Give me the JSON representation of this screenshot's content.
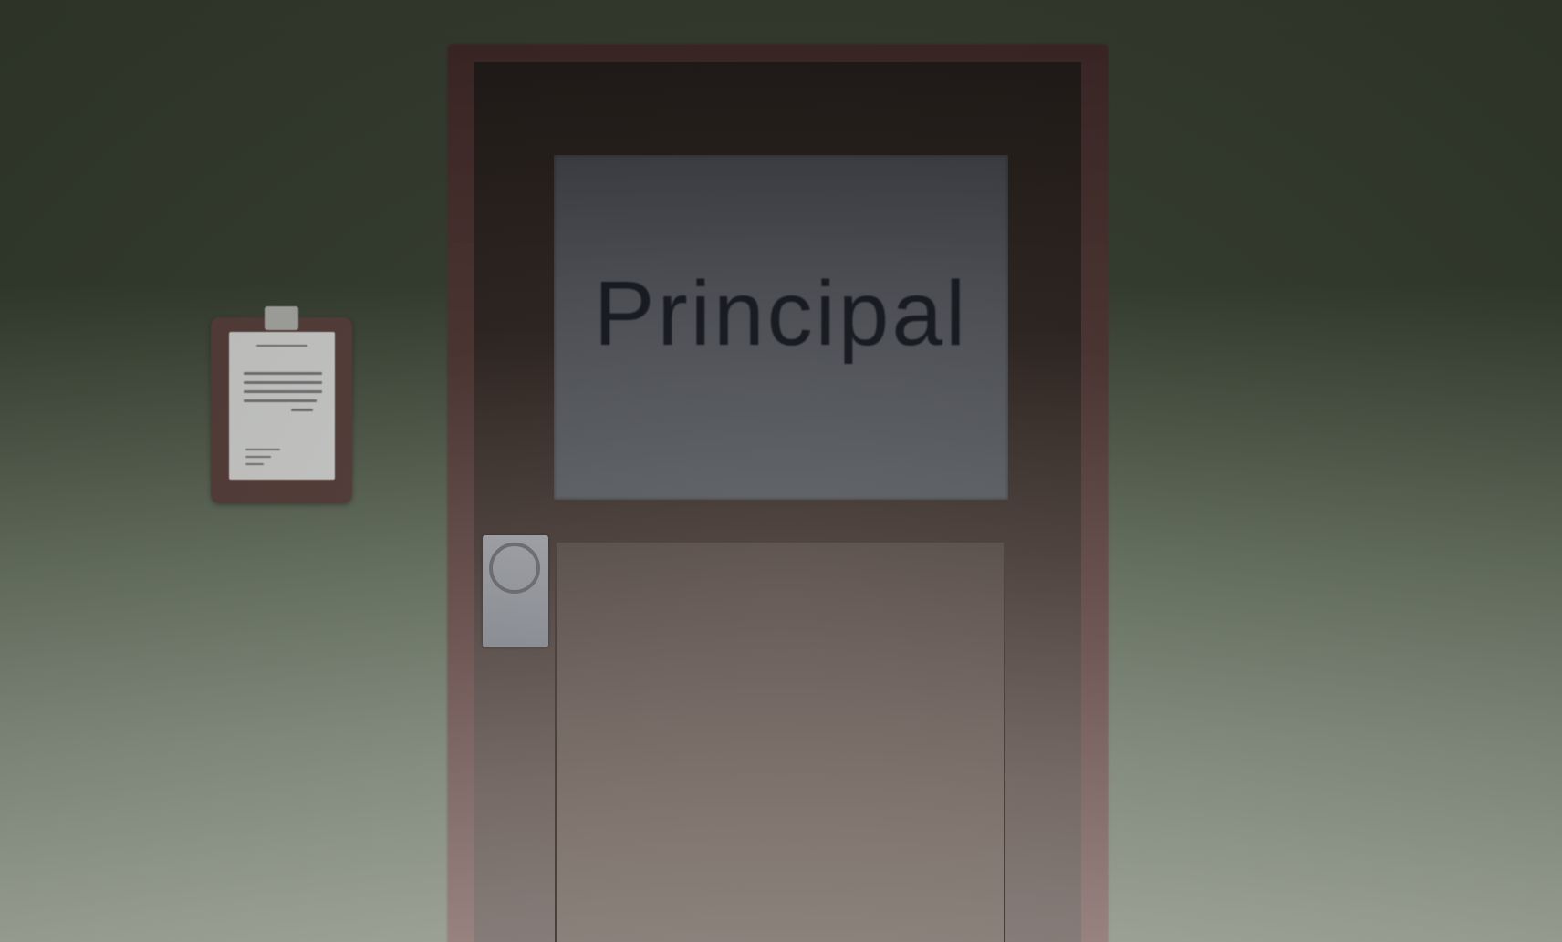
{
  "scene": {
    "door_sign_text": "Principal",
    "colors": {
      "wall_top": "#333a2c",
      "wall_bottom": "#a5ab9e",
      "door_frame": "#4a3330",
      "door_window": "#4b4d53",
      "sign_text": "#13161c",
      "clipboard": "#523b37",
      "lock_plate": "#9ea0a6"
    },
    "icons": {
      "door_knob": "door-knob-icon",
      "clipboard": "clipboard-icon"
    }
  }
}
